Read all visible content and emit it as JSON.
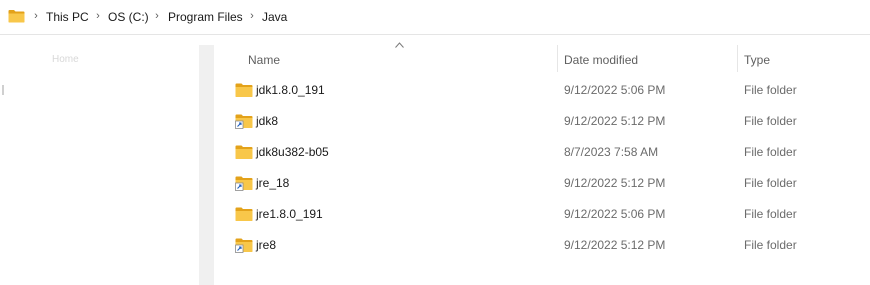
{
  "address_bar": {
    "breadcrumbs": [
      "This PC",
      "OS (C:)",
      "Program Files",
      "Java"
    ]
  },
  "nav_pane": {
    "faded_label": "Home"
  },
  "columns": {
    "name": "Name",
    "date_modified": "Date modified",
    "type": "Type",
    "sort": "ascending-by-name"
  },
  "files": [
    {
      "name": "jdk1.8.0_191",
      "date": "9/12/2022 5:06 PM",
      "type": "File folder",
      "icon": "folder-icon"
    },
    {
      "name": "jdk8",
      "date": "9/12/2022 5:12 PM",
      "type": "File folder",
      "icon": "folder-shortcut-icon"
    },
    {
      "name": "jdk8u382-b05",
      "date": "8/7/2023 7:58 AM",
      "type": "File folder",
      "icon": "folder-icon"
    },
    {
      "name": "jre_18",
      "date": "9/12/2022 5:12 PM",
      "type": "File folder",
      "icon": "folder-shortcut-icon"
    },
    {
      "name": "jre1.8.0_191",
      "date": "9/12/2022 5:06 PM",
      "type": "File folder",
      "icon": "folder-icon"
    },
    {
      "name": "jre8",
      "date": "9/12/2022 5:12 PM",
      "type": "File folder",
      "icon": "folder-shortcut-icon"
    }
  ],
  "colors": {
    "folder_yellow": "#f8c74a",
    "folder_dark": "#e3a21a",
    "header_text": "#5f5f5f",
    "muted_text": "#6b6b6b"
  }
}
